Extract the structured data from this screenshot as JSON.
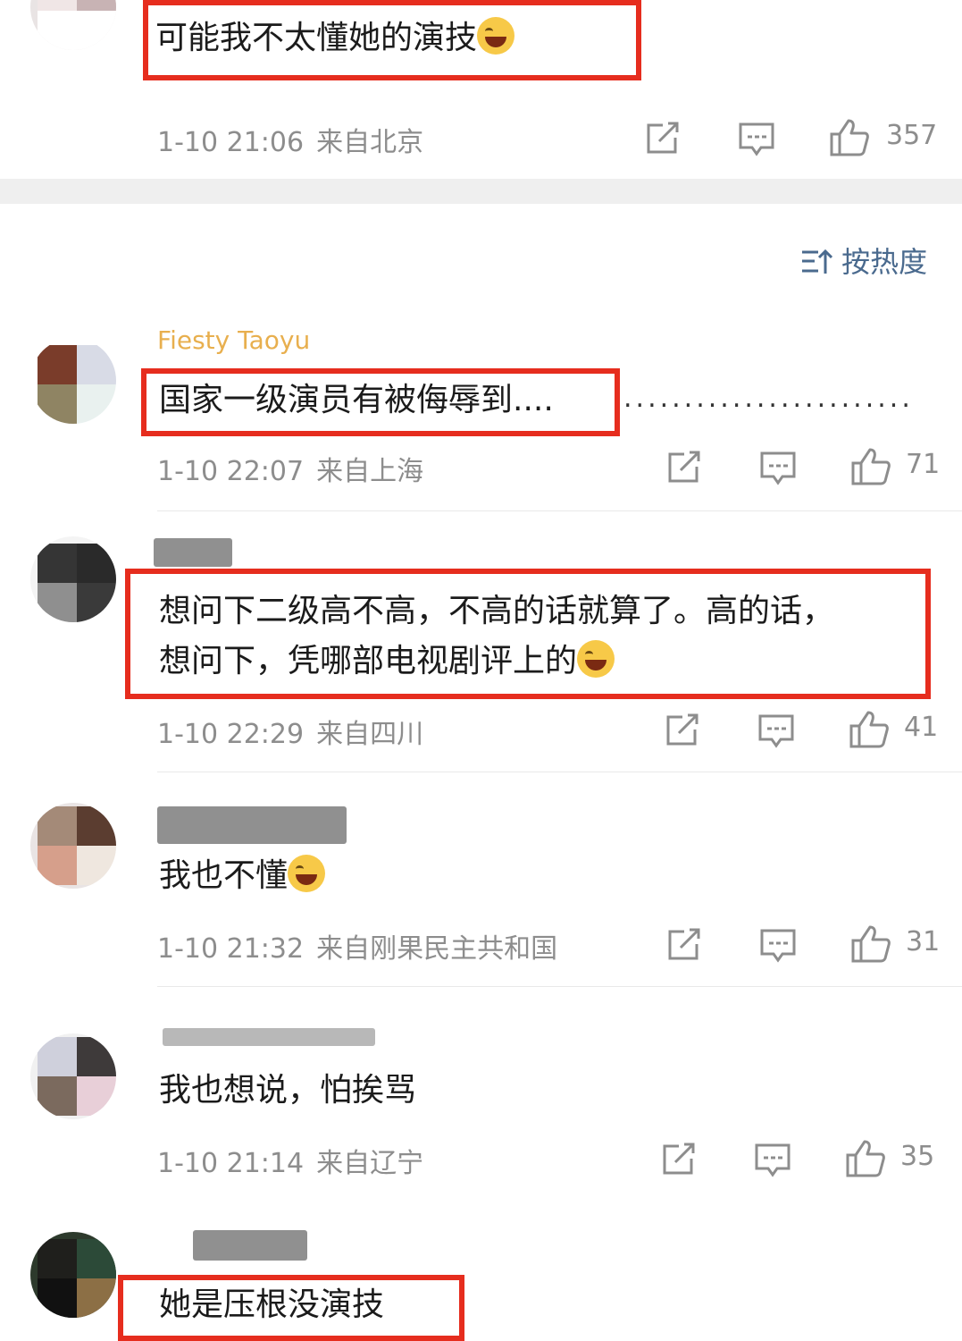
{
  "top_comment": {
    "text": "可能我不太懂她的演技",
    "emoji": "laugh-cry-emoji",
    "time": "1-10 21:06",
    "location": "来自北京",
    "likes": "357"
  },
  "sort": {
    "icon": "sort-icon",
    "label": "按热度"
  },
  "comments": [
    {
      "username": "Fiesty Taoyu",
      "text": "国家一级演员有被侮辱到....",
      "trailing_dots": "........................",
      "time": "1-10 22:07",
      "location": "来自上海",
      "likes": "71"
    },
    {
      "username": "",
      "line1": "想问下二级高不高，不高的话就算了。高的话，",
      "line2": "想问下，凭哪部电视剧评上的",
      "emoji": "laugh-cry-emoji",
      "time": "1-10 22:29",
      "location": "来自四川",
      "likes": "41"
    },
    {
      "username": "",
      "text": "我也不懂",
      "emoji": "laugh-cry-emoji",
      "time": "1-10 21:32",
      "location": "来自刚果民主共和国",
      "likes": "31"
    },
    {
      "username": "",
      "text": "我也想说，怕挨骂",
      "time": "1-10 21:14",
      "location": "来自辽宁",
      "likes": "35"
    },
    {
      "username": "",
      "text": "她是压根没演技"
    }
  ],
  "colors": {
    "highlight_box": "#e62d1e",
    "meta_text": "#8d8d8d",
    "sort_text": "#4a6a8e",
    "username_gold": "#e4a230"
  }
}
